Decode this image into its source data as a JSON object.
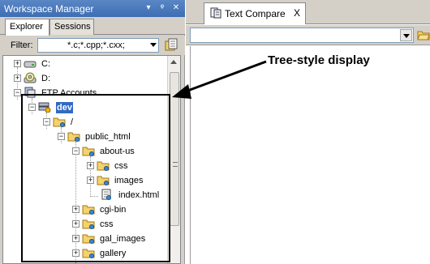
{
  "left_panel": {
    "title": "Workspace Manager",
    "title_buttons": {
      "dropdown": "▾",
      "pin": "ᵠ",
      "close": "✕"
    },
    "tabs": [
      {
        "label": "Explorer",
        "active": true
      },
      {
        "label": "Sessions",
        "active": false
      }
    ],
    "filter": {
      "label": "Filter:",
      "value": "*.c;*.cpp;*.cxx;"
    },
    "tree": [
      {
        "label": "C:",
        "icon": "hard-drive-icon",
        "expander": "+",
        "selected": false
      },
      {
        "label": "D:",
        "icon": "cd-drive-icon",
        "expander": "+",
        "selected": false
      },
      {
        "label": "FTP Accounts",
        "icon": "ftp-accounts-icon",
        "expander": "−",
        "selected": false
      },
      {
        "label": "dev",
        "icon": "ftp-server-icon",
        "expander": "−",
        "selected": true
      },
      {
        "label": "/",
        "icon": "folder-icon",
        "expander": "−",
        "selected": false
      },
      {
        "label": "public_html",
        "icon": "folder-icon",
        "expander": "−",
        "selected": false
      },
      {
        "label": "about-us",
        "icon": "folder-icon",
        "expander": "−",
        "selected": false
      },
      {
        "label": "css",
        "icon": "folder-icon",
        "expander": "+",
        "selected": false
      },
      {
        "label": "images",
        "icon": "folder-icon",
        "expander": "+",
        "selected": false
      },
      {
        "label": "index.html",
        "icon": "html-file-icon",
        "expander": "",
        "selected": false
      },
      {
        "label": "cgi-bin",
        "icon": "folder-icon",
        "expander": "+",
        "selected": false
      },
      {
        "label": "css",
        "icon": "folder-icon",
        "expander": "+",
        "selected": false
      },
      {
        "label": "gal_images",
        "icon": "folder-icon",
        "expander": "+",
        "selected": false
      },
      {
        "label": "gallery",
        "icon": "folder-icon",
        "expander": "+",
        "selected": false
      }
    ]
  },
  "right_panel": {
    "tab": {
      "label": "Text Compare",
      "close": "X"
    },
    "path_value": ""
  },
  "annotation": {
    "callout": "Tree-style display"
  },
  "colors": {
    "title_bar": "#3d6db3",
    "selection": "#316ac5",
    "folder": "#f5d26a",
    "panel_bg": "#d4d0c8"
  }
}
